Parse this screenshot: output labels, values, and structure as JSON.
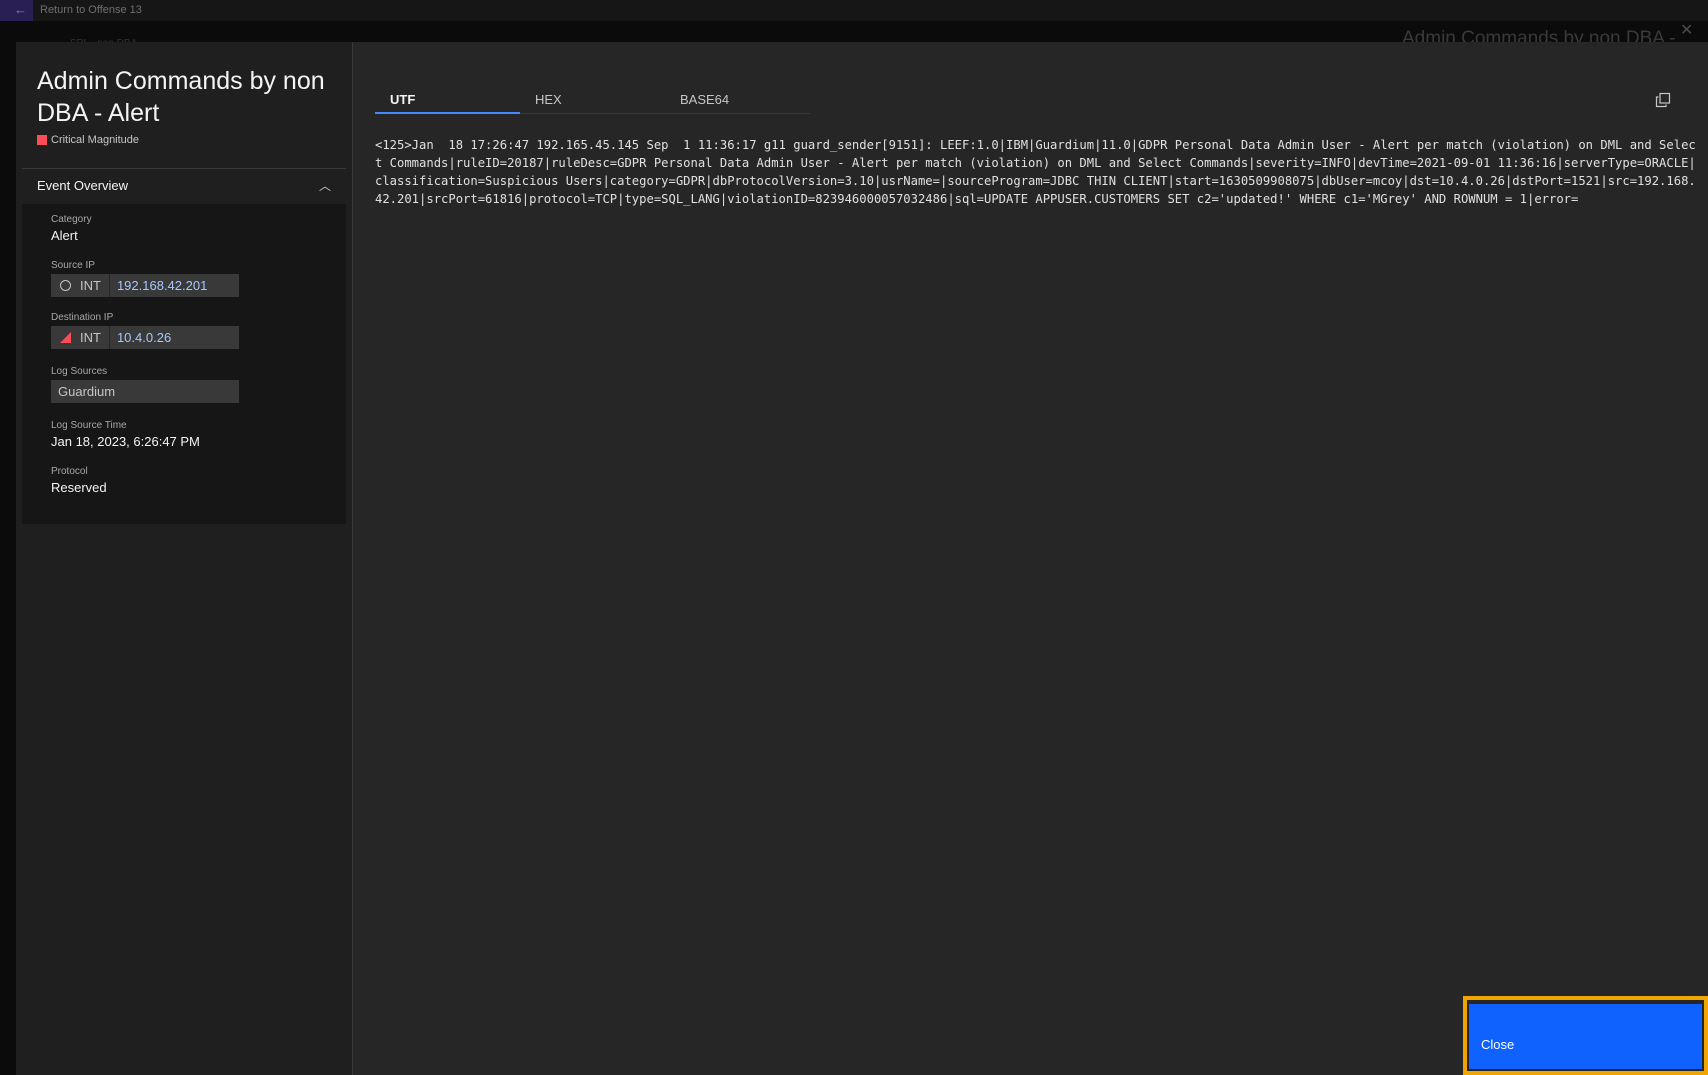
{
  "topbar": {
    "return_label": "Return to Offense 13",
    "background_title": "Admin Commands by non DBA -",
    "background_breadcrumb": "SPI... non DBA ..."
  },
  "modal": {
    "title": "Admin Commands by non DBA - Alert",
    "magnitude_label": "Critical Magnitude",
    "magnitude_color": "#fa4d56",
    "overview": {
      "header": "Event Overview",
      "category_label": "Category",
      "category_value": "Alert",
      "source_ip_label": "Source IP",
      "source_ip_flag": "INT",
      "source_ip_value": "192.168.42.201",
      "dest_ip_label": "Destination IP",
      "dest_ip_flag": "INT",
      "dest_ip_value": "10.4.0.26",
      "log_sources_label": "Log Sources",
      "log_sources_value": "Guardium",
      "log_source_time_label": "Log Source Time",
      "log_source_time_value": "Jan 18, 2023, 6:26:47 PM",
      "protocol_label": "Protocol",
      "protocol_value": "Reserved"
    },
    "tabs": [
      "UTF",
      "HEX",
      "BASE64"
    ],
    "active_tab": "UTF",
    "payload": "<125>Jan  18 17:26:47 192.165.45.145 Sep  1 11:36:17 g11 guard_sender[9151]: LEEF:1.0|IBM|Guardium|11.0|GDPR Personal Data Admin User - Alert per match (violation) on DML and Select Commands|ruleID=20187|ruleDesc=GDPR Personal Data Admin User - Alert per match (violation) on DML and Select Commands|severity=INFO|devTime=2021-09-01 11:36:16|serverType=ORACLE|classification=Suspicious Users|category=GDPR|dbProtocolVersion=3.10|usrName=|sourceProgram=JDBC THIN CLIENT|start=1630509908075|dbUser=mcoy|dst=10.4.0.26|dstPort=1521|src=192.168.42.201|srcPort=61816|protocol=TCP|type=SQL_LANG|violationID=823946000057032486|sql=UPDATE APPUSER.CUSTOMERS SET c2='updated!' WHERE c1='MGrey' AND ROWNUM = 1|error=",
    "close_label": "Close",
    "accent_color": "#0f62fe",
    "focus_color": "#f1a500"
  }
}
